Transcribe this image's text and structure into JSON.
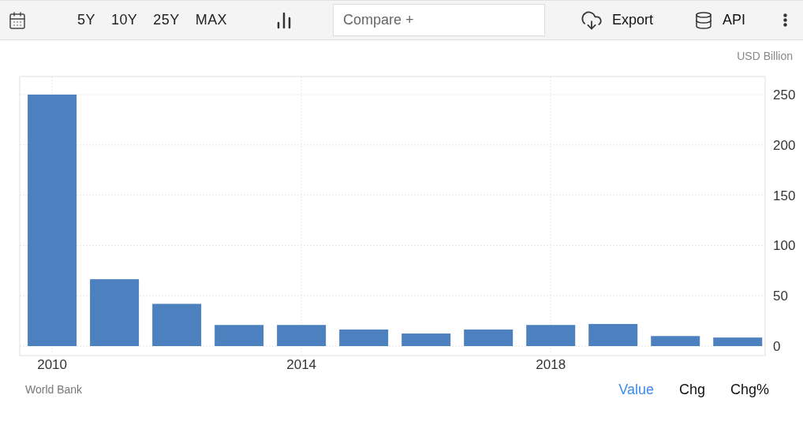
{
  "toolbar": {
    "ranges": [
      "5Y",
      "10Y",
      "25Y",
      "MAX"
    ],
    "compare": {
      "placeholder": "Compare +"
    },
    "actions": [
      {
        "kind": "export",
        "label": "Export"
      },
      {
        "kind": "api",
        "label": "API"
      }
    ]
  },
  "chart": {
    "unit": "USD Billion",
    "chart_data": {
      "type": "bar",
      "x": [
        2010,
        2011,
        2012,
        2013,
        2014,
        2015,
        2016,
        2017,
        2018,
        2019,
        2020,
        2021
      ],
      "series": [
        {
          "color": "#4d80bf",
          "values": [
            250,
            66.5,
            42,
            21,
            21,
            16.5,
            12.5,
            16.5,
            21,
            22,
            10,
            8.5
          ]
        }
      ],
      "xlim": [
        2009.48,
        2021.44
      ],
      "ylim": [
        -9.4,
        268
      ],
      "yticks": [
        {
          "value": 0,
          "label": "0"
        },
        {
          "value": 50,
          "label": "50"
        },
        {
          "value": 100,
          "label": "100"
        },
        {
          "value": 150,
          "label": "150"
        },
        {
          "value": 200,
          "label": "200"
        },
        {
          "value": 250,
          "label": "250"
        }
      ],
      "xticks": [
        {
          "value": 2010,
          "label": "2010"
        },
        {
          "value": 2014,
          "label": "2014"
        },
        {
          "value": 2018,
          "label": "2018"
        }
      ],
      "grid": true
    }
  },
  "footer": {
    "source": "World Bank",
    "tabs": [
      {
        "label": "Value",
        "selected": true
      },
      {
        "label": "Chg",
        "selected": false
      },
      {
        "label": "Chg%",
        "selected": false
      }
    ]
  }
}
